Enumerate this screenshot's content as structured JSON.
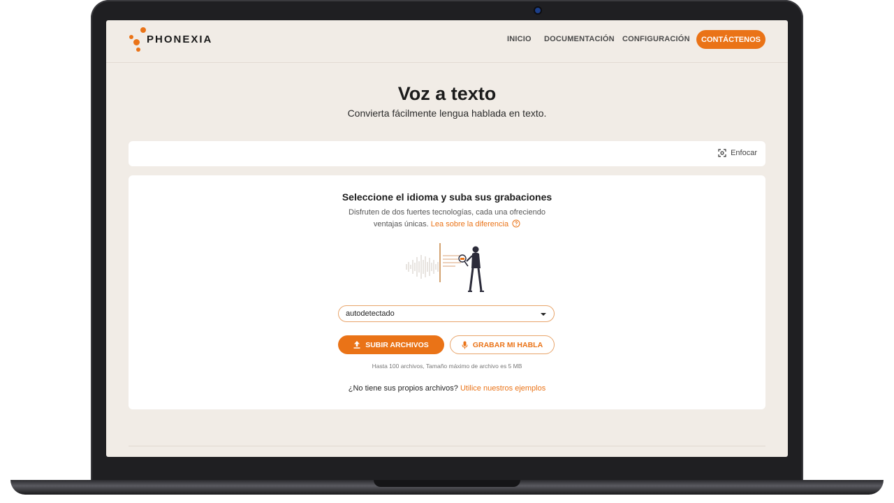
{
  "brand": {
    "name": "PHONEXIA",
    "accent": "#ea7317"
  },
  "nav": {
    "items": [
      "INICIO",
      "DOCUMENTACIÓN",
      "CONFIGURACIÓN"
    ],
    "cta": "CONTÁCTENOS"
  },
  "hero": {
    "title": "Voz a texto",
    "subtitle": "Convierta fácilmente lengua hablada en texto."
  },
  "focus": {
    "label": "Enfocar",
    "icon": "focus-icon"
  },
  "card": {
    "title": "Seleccione el idioma y suba sus grabaciones",
    "desc_text": "Disfruten de dos fuertes tecnologías, cada una ofreciendo ventajas únicas.",
    "desc_link": "Lea sobre la diferencia",
    "help_icon": "help-circle-icon",
    "illustration_icon": "speech-analysis-illustration",
    "language_select": {
      "value": "autodetectado"
    },
    "upload_button": "SUBIR ARCHIVOS",
    "upload_icon": "upload-icon",
    "record_button": "GRABAR MI HABLA",
    "record_icon": "microphone-icon",
    "limits": "Hasta 100 archivos, Tamaño máximo de archivo es 5 MB",
    "examples_text": "¿No tiene sus propios archivos?",
    "examples_link": "Utilice nuestros ejemplos"
  }
}
